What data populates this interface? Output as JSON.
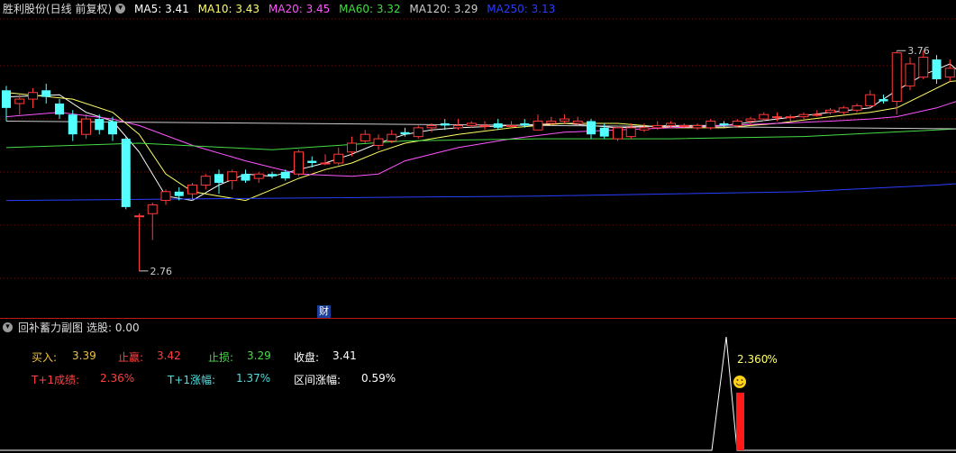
{
  "header": {
    "stock_title": "胜利股份(日线 前复权)",
    "ma": [
      {
        "label": "MA5: 3.41",
        "color": "#ffffff"
      },
      {
        "label": "MA10: 3.43",
        "color": "#ffff66"
      },
      {
        "label": "MA20: 3.45",
        "color": "#ff55ff"
      },
      {
        "label": "MA60: 3.32",
        "color": "#44dd44"
      },
      {
        "label": "MA120: 3.29",
        "color": "#cccccc"
      },
      {
        "label": "MA250: 3.13",
        "color": "#2a3cff"
      }
    ]
  },
  "chart_data": {
    "type": "candlestick",
    "ylim": [
      2.6,
      3.9
    ],
    "candles": [
      [
        3.58,
        3.5,
        3.6,
        3.44
      ],
      [
        3.52,
        3.54,
        3.56,
        3.47
      ],
      [
        3.54,
        3.57,
        3.59,
        3.5
      ],
      [
        3.58,
        3.55,
        3.61,
        3.52
      ],
      [
        3.52,
        3.47,
        3.54,
        3.45
      ],
      [
        3.47,
        3.38,
        3.49,
        3.35
      ],
      [
        3.38,
        3.45,
        3.47,
        3.36
      ],
      [
        3.45,
        3.4,
        3.47,
        3.38
      ],
      [
        3.44,
        3.38,
        3.46,
        3.35
      ],
      [
        3.36,
        3.05,
        3.37,
        3.04
      ],
      [
        3.01,
        3.01,
        3.02,
        2.76
      ],
      [
        3.02,
        3.06,
        3.07,
        2.9
      ],
      [
        3.08,
        3.12,
        3.13,
        3.06
      ],
      [
        3.12,
        3.1,
        3.14,
        3.08
      ],
      [
        3.11,
        3.15,
        3.16,
        3.08
      ],
      [
        3.15,
        3.19,
        3.2,
        3.13
      ],
      [
        3.2,
        3.16,
        3.22,
        3.11
      ],
      [
        3.17,
        3.21,
        3.22,
        3.13
      ],
      [
        3.2,
        3.17,
        3.22,
        3.16
      ],
      [
        3.18,
        3.2,
        3.21,
        3.16
      ],
      [
        3.2,
        3.19,
        3.21,
        3.18
      ],
      [
        3.21,
        3.18,
        3.22,
        3.17
      ],
      [
        3.2,
        3.3,
        3.31,
        3.19
      ],
      [
        3.26,
        3.25,
        3.28,
        3.23
      ],
      [
        3.25,
        3.25,
        3.29,
        3.24
      ],
      [
        3.25,
        3.29,
        3.32,
        3.24
      ],
      [
        3.3,
        3.34,
        3.37,
        3.28
      ],
      [
        3.35,
        3.38,
        3.4,
        3.34
      ],
      [
        3.33,
        3.36,
        3.38,
        3.31
      ],
      [
        3.35,
        3.38,
        3.4,
        3.34
      ],
      [
        3.39,
        3.38,
        3.41,
        3.37
      ],
      [
        3.37,
        3.41,
        3.42,
        3.36
      ],
      [
        3.41,
        3.42,
        3.43,
        3.39
      ],
      [
        3.43,
        3.42,
        3.45,
        3.4
      ],
      [
        3.41,
        3.42,
        3.45,
        3.4
      ],
      [
        3.42,
        3.43,
        3.44,
        3.41
      ],
      [
        3.42,
        3.42,
        3.44,
        3.4
      ],
      [
        3.43,
        3.41,
        3.45,
        3.4
      ],
      [
        3.42,
        3.42,
        3.44,
        3.41
      ],
      [
        3.43,
        3.42,
        3.45,
        3.41
      ],
      [
        3.4,
        3.44,
        3.47,
        3.4
      ],
      [
        3.43,
        3.44,
        3.46,
        3.42
      ],
      [
        3.44,
        3.45,
        3.47,
        3.43
      ],
      [
        3.43,
        3.44,
        3.46,
        3.42
      ],
      [
        3.44,
        3.38,
        3.45,
        3.36
      ],
      [
        3.41,
        3.37,
        3.43,
        3.36
      ],
      [
        3.36,
        3.41,
        3.42,
        3.35
      ],
      [
        3.37,
        3.41,
        3.43,
        3.36
      ],
      [
        3.4,
        3.41,
        3.43,
        3.39
      ],
      [
        3.41,
        3.42,
        3.44,
        3.4
      ],
      [
        3.42,
        3.43,
        3.44,
        3.41
      ],
      [
        3.42,
        3.42,
        3.43,
        3.41
      ],
      [
        3.41,
        3.42,
        3.43,
        3.4
      ],
      [
        3.41,
        3.44,
        3.45,
        3.4
      ],
      [
        3.43,
        3.42,
        3.44,
        3.41
      ],
      [
        3.42,
        3.44,
        3.45,
        3.41
      ],
      [
        3.44,
        3.45,
        3.46,
        3.42
      ],
      [
        3.45,
        3.47,
        3.48,
        3.44
      ],
      [
        3.46,
        3.46,
        3.48,
        3.44
      ],
      [
        3.46,
        3.46,
        3.47,
        3.44
      ],
      [
        3.46,
        3.47,
        3.48,
        3.45
      ],
      [
        3.47,
        3.47,
        3.49,
        3.46
      ],
      [
        3.48,
        3.49,
        3.5,
        3.47
      ],
      [
        3.48,
        3.5,
        3.51,
        3.47
      ],
      [
        3.49,
        3.51,
        3.52,
        3.48
      ],
      [
        3.51,
        3.56,
        3.58,
        3.5
      ],
      [
        3.54,
        3.53,
        3.56,
        3.52
      ],
      [
        3.53,
        3.75,
        3.76,
        3.47
      ],
      [
        3.6,
        3.7,
        3.73,
        3.58
      ],
      [
        3.64,
        3.73,
        3.76,
        3.63
      ],
      [
        3.72,
        3.63,
        3.74,
        3.61
      ],
      [
        3.64,
        3.68,
        3.72,
        3.62
      ],
      [
        3.66,
        3.72,
        3.74,
        3.64
      ],
      [
        3.56,
        3.54,
        3.58,
        3.43
      ],
      [
        3.53,
        3.52,
        3.54,
        3.51
      ],
      [
        3.53,
        3.51,
        3.54,
        3.48
      ],
      [
        3.51,
        3.52,
        3.54,
        3.5
      ],
      [
        3.52,
        3.52,
        3.53,
        3.5
      ],
      [
        3.52,
        3.53,
        3.54,
        3.51
      ],
      [
        3.53,
        3.53,
        3.54,
        3.52
      ],
      [
        3.53,
        3.55,
        3.56,
        3.52
      ],
      [
        3.55,
        3.55,
        3.57,
        3.53
      ],
      [
        3.55,
        3.55,
        3.57,
        3.54
      ]
    ],
    "ma_lines": [
      {
        "name": "MA5",
        "color": "#ffffff",
        "values": [
          [
            0,
            3.55
          ],
          [
            4,
            3.56
          ],
          [
            6,
            3.48
          ],
          [
            8,
            3.44
          ],
          [
            10,
            3.3
          ],
          [
            12,
            3.1
          ],
          [
            14,
            3.08
          ],
          [
            16,
            3.15
          ],
          [
            18,
            3.2
          ],
          [
            20,
            3.19
          ],
          [
            22,
            3.22
          ],
          [
            24,
            3.25
          ],
          [
            26,
            3.29
          ],
          [
            28,
            3.34
          ],
          [
            30,
            3.38
          ],
          [
            32,
            3.4
          ],
          [
            34,
            3.41
          ],
          [
            38,
            3.42
          ],
          [
            42,
            3.43
          ],
          [
            46,
            3.41
          ],
          [
            50,
            3.42
          ],
          [
            54,
            3.42
          ],
          [
            58,
            3.45
          ],
          [
            62,
            3.48
          ],
          [
            65,
            3.5
          ],
          [
            67,
            3.58
          ],
          [
            69,
            3.65
          ],
          [
            71,
            3.7
          ],
          [
            73,
            3.6
          ],
          [
            75,
            3.52
          ],
          [
            78,
            3.52
          ],
          [
            82,
            3.55
          ]
        ]
      },
      {
        "name": "MA10",
        "color": "#ffff66",
        "values": [
          [
            0,
            3.57
          ],
          [
            5,
            3.54
          ],
          [
            8,
            3.48
          ],
          [
            10,
            3.38
          ],
          [
            12,
            3.2
          ],
          [
            14,
            3.12
          ],
          [
            16,
            3.1
          ],
          [
            18,
            3.08
          ],
          [
            20,
            3.13
          ],
          [
            22,
            3.18
          ],
          [
            24,
            3.22
          ],
          [
            26,
            3.25
          ],
          [
            28,
            3.3
          ],
          [
            30,
            3.34
          ],
          [
            34,
            3.38
          ],
          [
            38,
            3.41
          ],
          [
            42,
            3.43
          ],
          [
            46,
            3.43
          ],
          [
            50,
            3.41
          ],
          [
            54,
            3.41
          ],
          [
            58,
            3.43
          ],
          [
            62,
            3.46
          ],
          [
            65,
            3.48
          ],
          [
            67,
            3.5
          ],
          [
            69,
            3.56
          ],
          [
            71,
            3.62
          ],
          [
            73,
            3.63
          ],
          [
            75,
            3.62
          ],
          [
            78,
            3.6
          ],
          [
            80,
            3.57
          ],
          [
            82,
            3.56
          ]
        ]
      },
      {
        "name": "MA20",
        "color": "#ff55ff",
        "values": [
          [
            0,
            3.46
          ],
          [
            4,
            3.48
          ],
          [
            8,
            3.45
          ],
          [
            10,
            3.42
          ],
          [
            14,
            3.33
          ],
          [
            18,
            3.26
          ],
          [
            22,
            3.2
          ],
          [
            26,
            3.19
          ],
          [
            28,
            3.2
          ],
          [
            30,
            3.26
          ],
          [
            34,
            3.32
          ],
          [
            38,
            3.36
          ],
          [
            42,
            3.39
          ],
          [
            46,
            3.4
          ],
          [
            50,
            3.41
          ],
          [
            54,
            3.42
          ],
          [
            58,
            3.43
          ],
          [
            62,
            3.44
          ],
          [
            65,
            3.45
          ],
          [
            67,
            3.46
          ],
          [
            70,
            3.5
          ],
          [
            72,
            3.54
          ],
          [
            74,
            3.55
          ],
          [
            76,
            3.56
          ],
          [
            80,
            3.57
          ],
          [
            82,
            3.57
          ]
        ]
      },
      {
        "name": "MA60",
        "color": "#44dd44",
        "values": [
          [
            0,
            3.32
          ],
          [
            10,
            3.34
          ],
          [
            20,
            3.31
          ],
          [
            30,
            3.35
          ],
          [
            40,
            3.36
          ],
          [
            50,
            3.36
          ],
          [
            60,
            3.37
          ],
          [
            70,
            3.4
          ],
          [
            82,
            3.44
          ]
        ]
      },
      {
        "name": "MA120",
        "color": "#cccccc",
        "values": [
          [
            0,
            3.44
          ],
          [
            82,
            3.4
          ]
        ]
      },
      {
        "name": "MA250",
        "color": "#2a3cff",
        "values": [
          [
            0,
            3.08
          ],
          [
            40,
            3.1
          ],
          [
            60,
            3.12
          ],
          [
            70,
            3.15
          ],
          [
            82,
            3.2
          ]
        ]
      }
    ],
    "annotations": [
      {
        "text": "3.76",
        "candle": 67,
        "price": 3.76
      },
      {
        "text": "2.76",
        "candle": 10,
        "price": 2.76
      }
    ]
  },
  "news_marker": "财",
  "sub_panel": {
    "title": "回补蓄力副图",
    "pick_label": "选股: 0.00",
    "buy_label": "买入:",
    "buy_value": "3.39",
    "tp_label": "止赢:",
    "tp_value": "3.42",
    "sl_label": "止损:",
    "sl_value": "3.29",
    "close_label": "收盘:",
    "close_value": "3.41",
    "t1_result_label": "T+1成绩:",
    "t1_result_value": "2.36%",
    "t1_gain_label": "T+1涨幅:",
    "t1_gain_value": "1.37%",
    "range_label": "区间涨幅:",
    "range_value": "0.59%",
    "signal_label": "2.360",
    "signal_pct": "%",
    "colors": {
      "buy": "#f0c040",
      "tp": "#ff4040",
      "sl": "#44dd44",
      "t1r": "#ff4040",
      "t1g": "#55dddd",
      "white": "#ffffff"
    }
  }
}
